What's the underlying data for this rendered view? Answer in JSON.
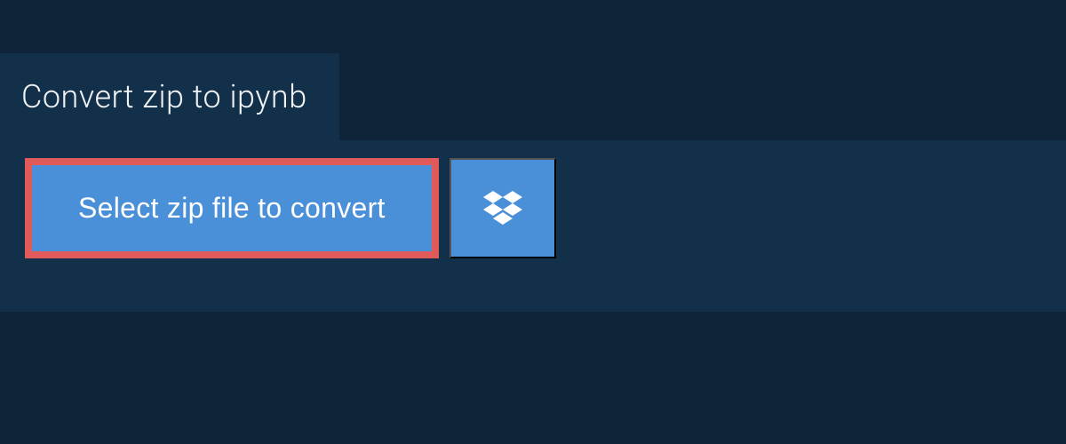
{
  "header": {
    "title": "Convert zip to ipynb"
  },
  "main": {
    "select_button_label": "Select zip file to convert"
  }
}
